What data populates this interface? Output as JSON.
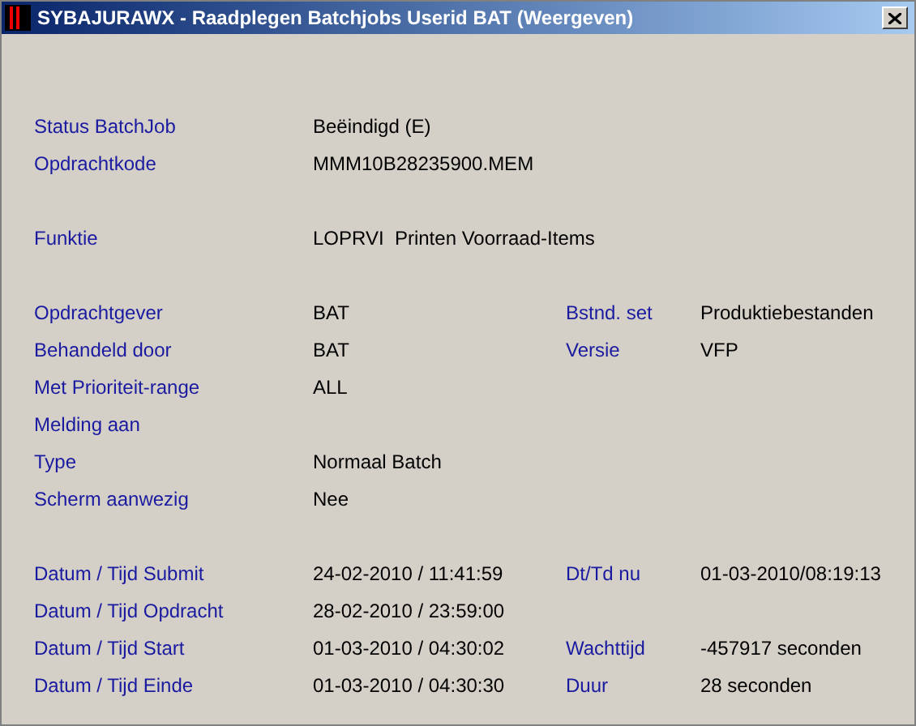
{
  "window": {
    "title": "SYBAJURAWX - Raadplegen Batchjobs Userid BAT (Weergeven)"
  },
  "sections": [
    {
      "rows": [
        {
          "label": "Status BatchJob",
          "value": "Beëindigd (E)"
        },
        {
          "label": "Opdrachtkode",
          "value": "MMM10B28235900.MEM"
        }
      ]
    },
    {
      "rows": [
        {
          "label": "Funktie",
          "value": "LOPRVI  Printen Voorraad-Items"
        }
      ]
    },
    {
      "rows": [
        {
          "label": "Opdrachtgever",
          "value": "BAT",
          "label2": "Bstnd. set",
          "value2": "Produktiebestanden"
        },
        {
          "label": "Behandeld door",
          "value": "BAT",
          "label2": "Versie",
          "value2": "VFP"
        },
        {
          "label": "Met Prioriteit-range",
          "value": "ALL"
        },
        {
          "label": "Melding aan"
        },
        {
          "label": "Type",
          "value": "Normaal Batch"
        },
        {
          "label": "Scherm aanwezig",
          "value": "Nee"
        }
      ]
    },
    {
      "rows": [
        {
          "label": "Datum / Tijd Submit",
          "value": "24-02-2010 / 11:41:59",
          "label2": "Dt/Td nu",
          "value2": "01-03-2010/08:19:13"
        },
        {
          "label": "Datum / Tijd Opdracht",
          "value": "28-02-2010 / 23:59:00"
        },
        {
          "label": "Datum / Tijd Start",
          "value": "01-03-2010 / 04:30:02",
          "label2": "Wachttijd",
          "value2": "-457917 seconden"
        },
        {
          "label": "Datum / Tijd Einde",
          "value": "01-03-2010 / 04:30:30",
          "label2": "Duur",
          "value2": "28 seconden"
        }
      ]
    }
  ]
}
